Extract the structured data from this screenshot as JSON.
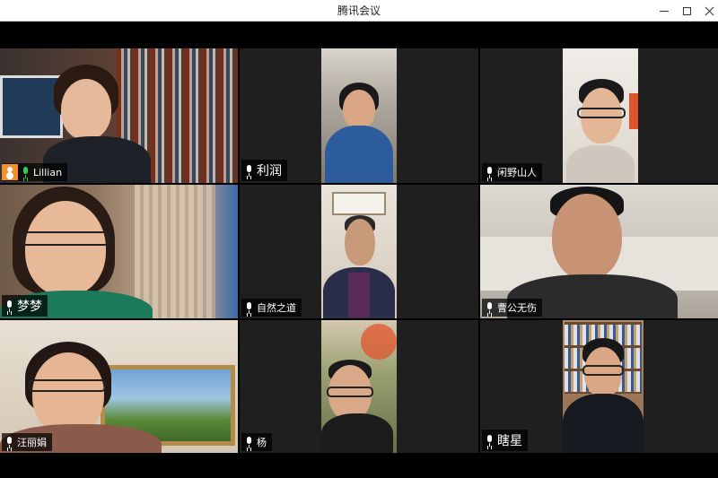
{
  "window": {
    "title": "腾讯会议",
    "min_icon": "minimize-icon",
    "max_icon": "maximize-icon",
    "close_icon": "close-icon"
  },
  "colors": {
    "tile_bg": "#1f1f1f",
    "active_border": "#2fcc55",
    "host_badge": "#f2902b"
  },
  "participants": [
    {
      "name": "Lillian",
      "host": true,
      "speaking": true
    },
    {
      "name": "利润"
    },
    {
      "name": "闲野山人"
    },
    {
      "name": "梦梦"
    },
    {
      "name": "自然之道"
    },
    {
      "name": "曹公无伤"
    },
    {
      "name": "汪丽娟",
      "active": true
    },
    {
      "name": "杨"
    },
    {
      "name": "瞎星"
    }
  ]
}
